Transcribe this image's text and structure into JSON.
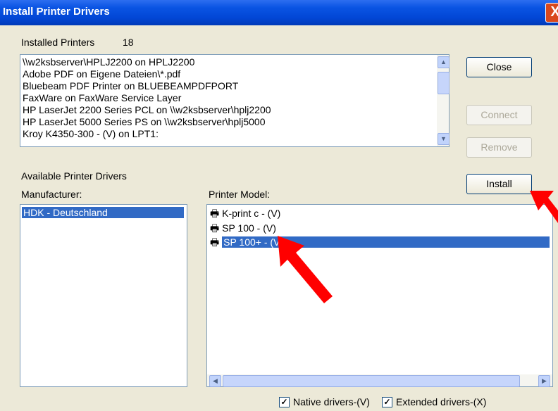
{
  "window": {
    "title": "Install Printer Drivers",
    "close_glyph": "X"
  },
  "installed": {
    "label": "Installed Printers",
    "count": "18",
    "items": [
      "\\\\w2ksbserver\\HPLJ2200 on HPLJ2200",
      "Adobe PDF on Eigene Dateien\\*.pdf",
      "Bluebeam PDF Printer on BLUEBEAMPDFPORT",
      "FaxWare on FaxWare Service Layer",
      "HP LaserJet 2200 Series PCL on \\\\w2ksbserver\\hplj2200",
      "HP LaserJet 5000 Series PS on \\\\w2ksbserver\\hplj5000",
      "Kroy K4350-300 - (V) on LPT1:"
    ]
  },
  "buttons": {
    "close": "Close",
    "connect": "Connect",
    "remove": "Remove",
    "install": "Install"
  },
  "available": {
    "label": "Available Printer Drivers",
    "manufacturer_label": "Manufacturer:",
    "manufacturers": [
      "HDK - Deutschland"
    ],
    "model_label": "Printer Model:",
    "models": [
      "K-print c - (V)",
      "SP 100 - (V)",
      "SP 100+ - (V)"
    ],
    "selected_model_index": 2
  },
  "checkboxes": {
    "native": {
      "label": "Native drivers-(V)",
      "checked": true
    },
    "extended": {
      "label": "Extended drivers-(X)",
      "checked": true
    }
  },
  "colors": {
    "selection": "#316ac5",
    "annotation_arrow": "#ff0000",
    "titlebar": "#0247d6"
  }
}
